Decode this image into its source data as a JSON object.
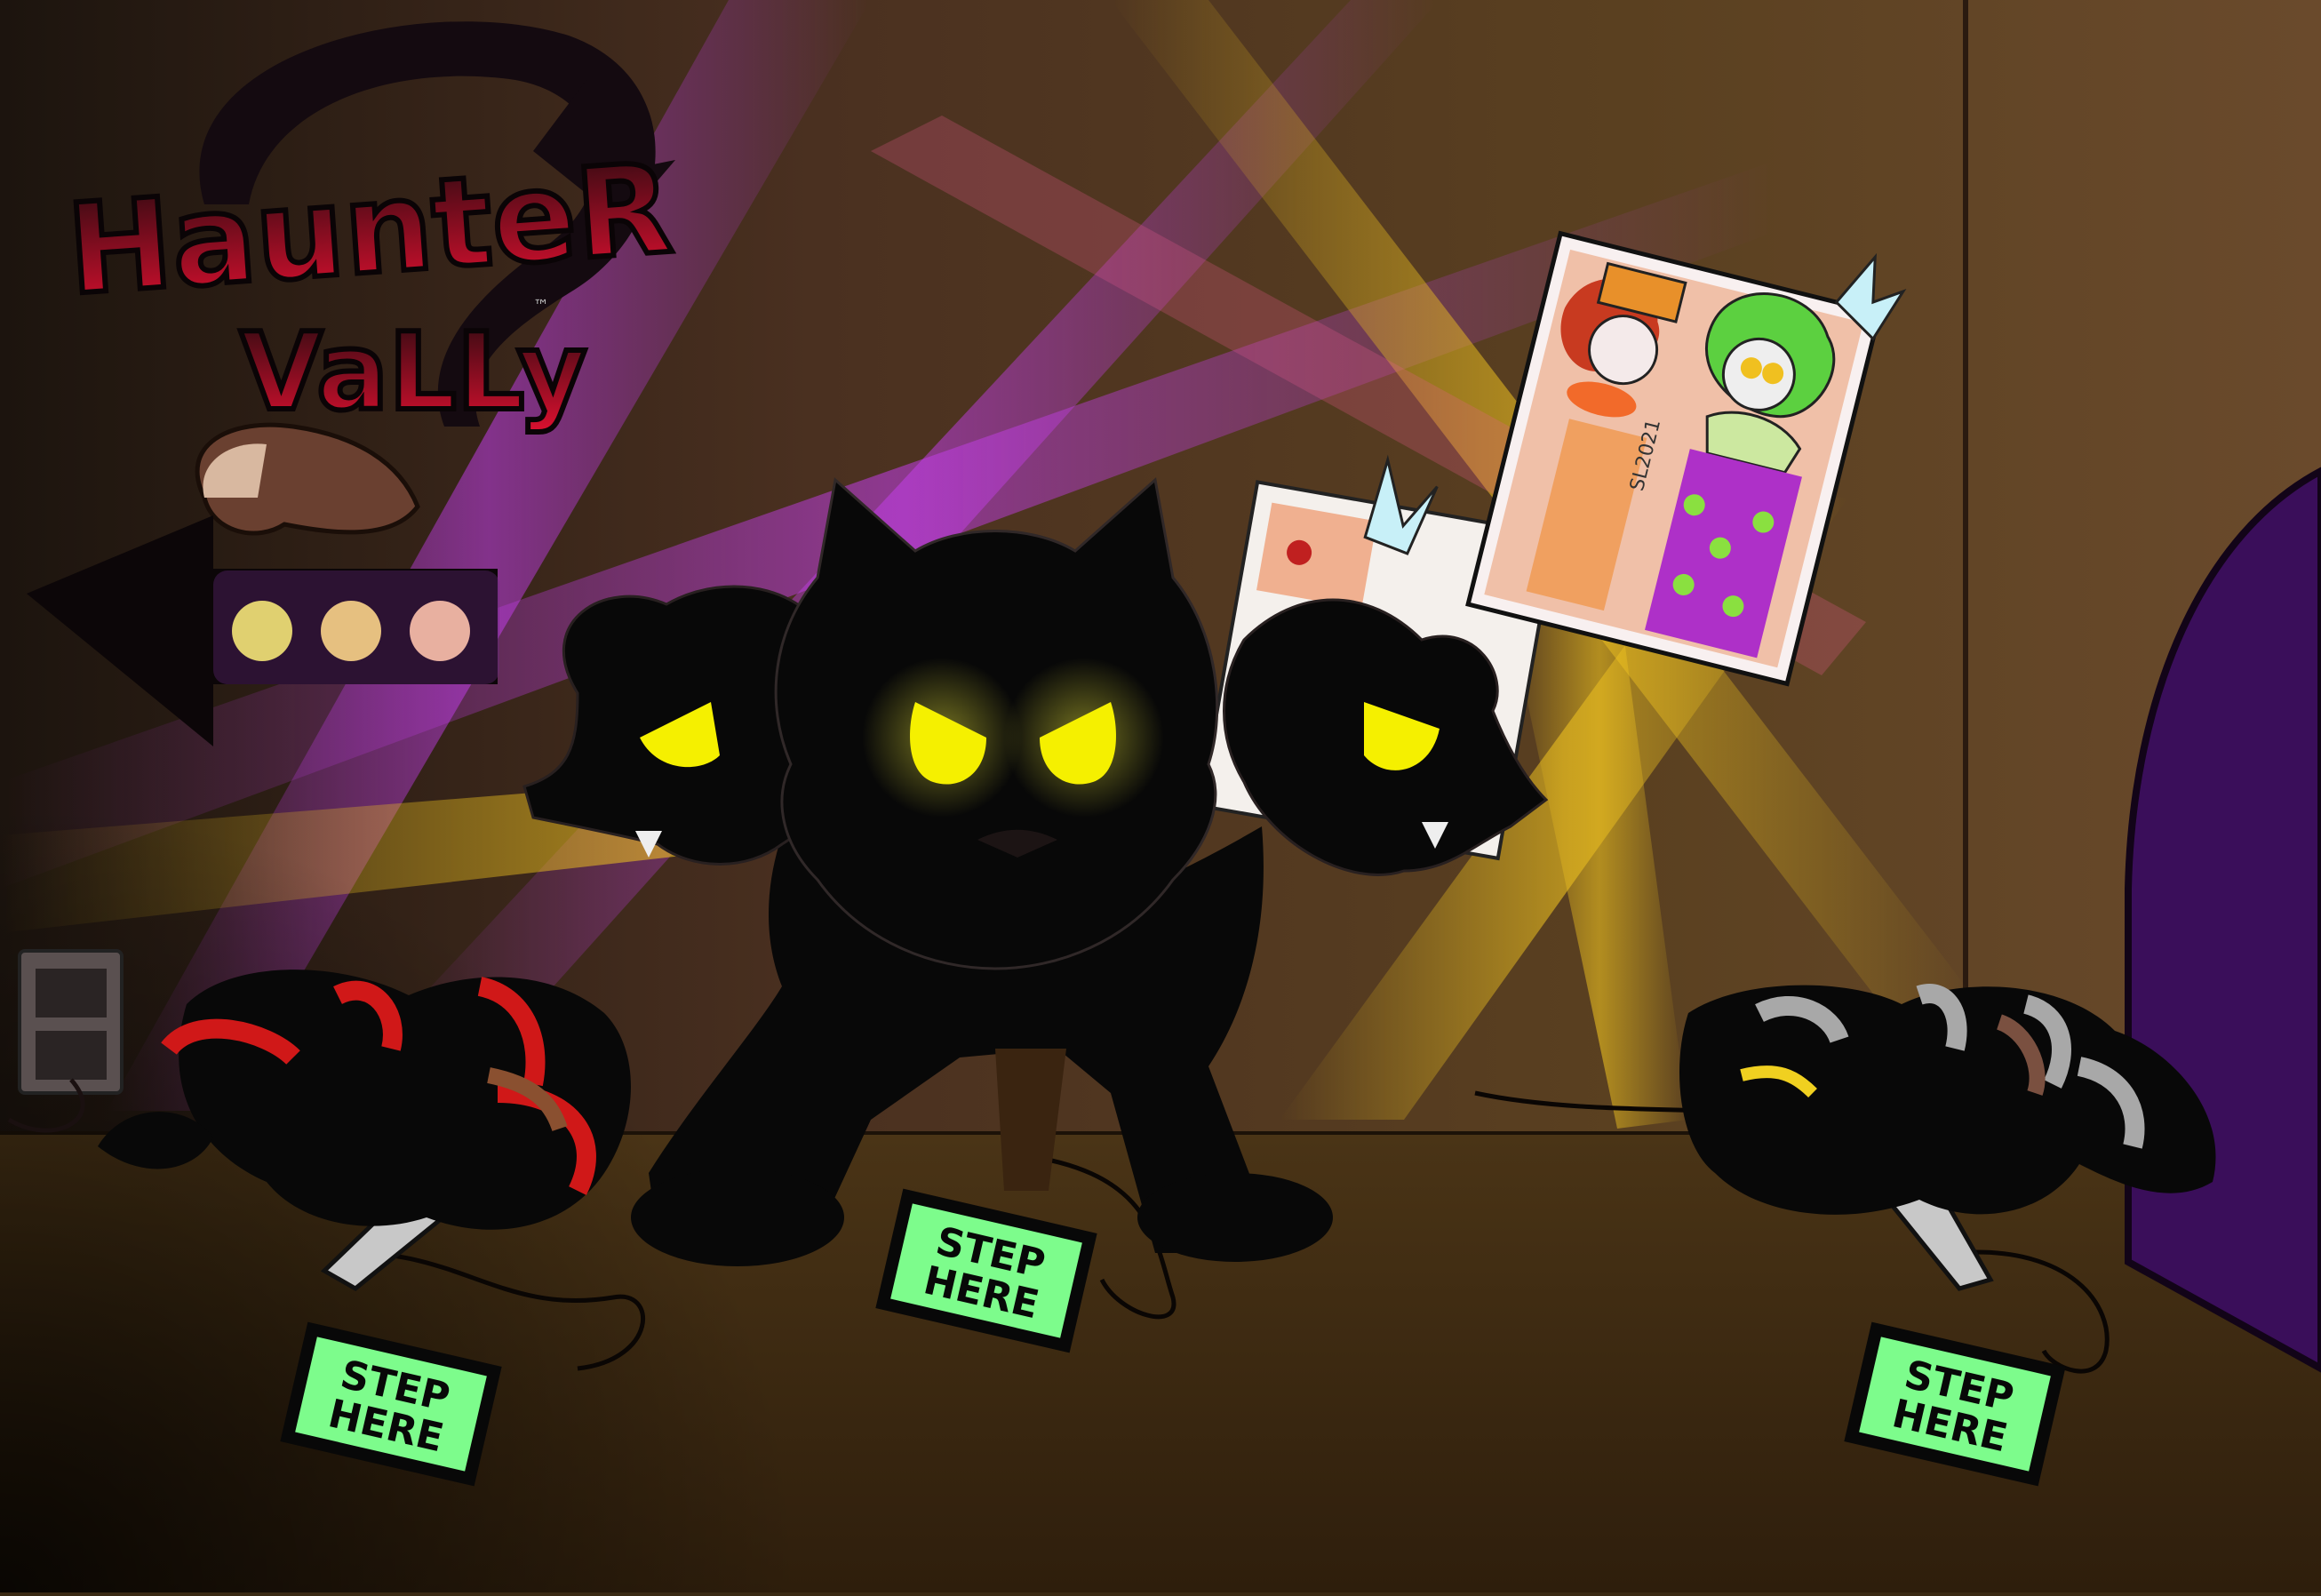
{
  "sign": {
    "line1": "HauntеR",
    "line2": "VaLLy",
    "tm": "™"
  },
  "pads": [
    {
      "line1": "STEP",
      "line2": "HERE"
    },
    {
      "line1": "STEP",
      "line2": "HERE"
    },
    {
      "line1": "STEP",
      "line2": "HERE"
    }
  ],
  "signature": "SL2021",
  "colors": {
    "wall": "#4a3418",
    "floor": "#3d2a12",
    "light_purple": "#c040e0",
    "light_yellow": "#f0c020",
    "eyes": "#f5f000",
    "pad_green": "#7dfc8c",
    "door": "#3a0e5a"
  }
}
